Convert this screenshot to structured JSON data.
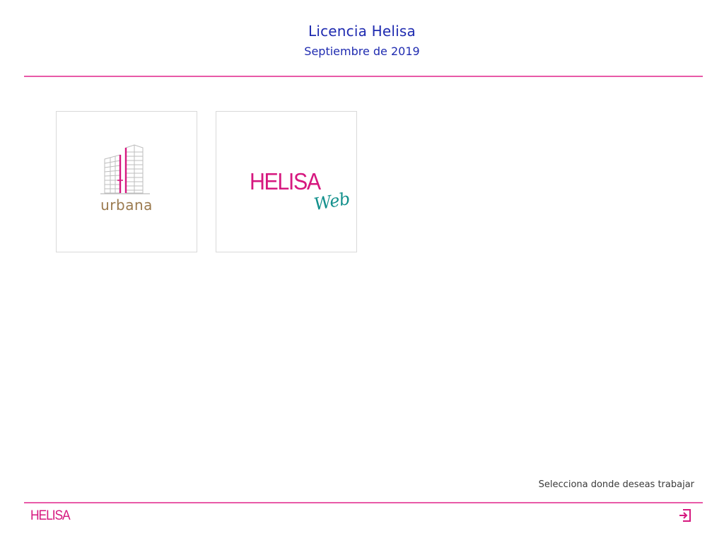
{
  "header": {
    "title": "Licencia Helisa",
    "subtitle": "Septiembre de 2019"
  },
  "tiles": [
    {
      "name": "urbana",
      "label": "urbana"
    },
    {
      "name": "helisa-web",
      "brand": "HELISA",
      "sub": "Web"
    }
  ],
  "footer": {
    "hint": "Selecciona donde deseas trabajar",
    "logo": "HELISA",
    "logout_icon": "logout-icon"
  },
  "colors": {
    "title_blue": "#1f2bb0",
    "accent_pink": "#e85aa8",
    "brand_magenta": "#d6187f",
    "web_teal": "#12908c",
    "urbana_brown": "#9b7a4e"
  }
}
